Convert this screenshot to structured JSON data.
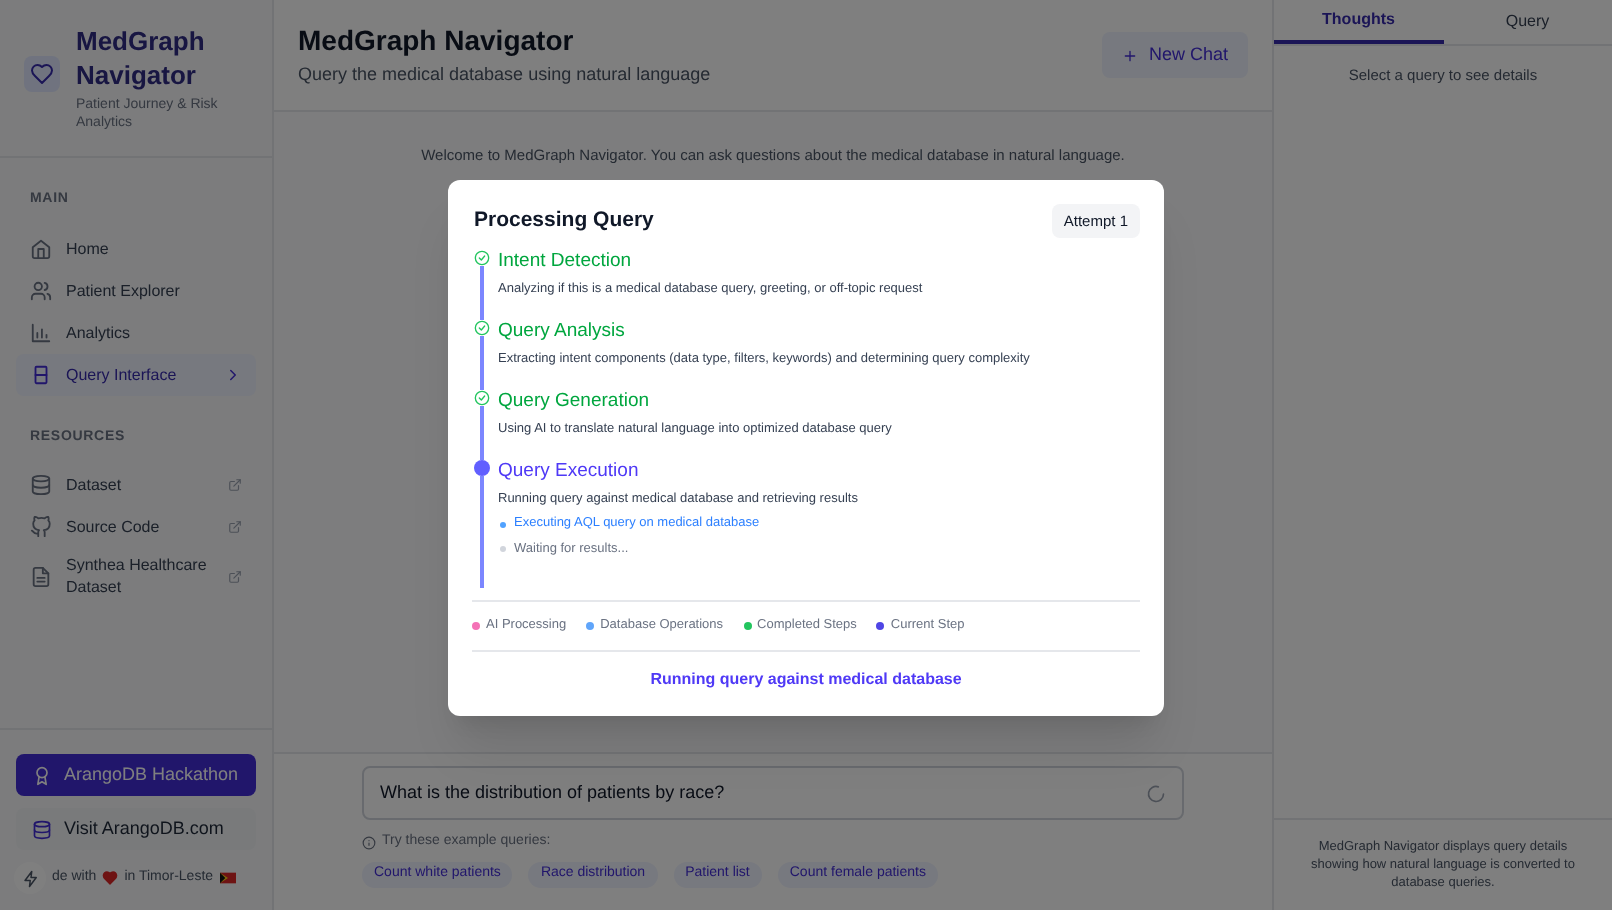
{
  "sidebar": {
    "app_title": "MedGraph Navigator",
    "app_subtitle": "Patient Journey & Risk Analytics",
    "sections": [
      {
        "title": "MAIN",
        "items": [
          {
            "label": "Home",
            "selected": false,
            "external": false
          },
          {
            "label": "Patient Explorer",
            "selected": false,
            "external": false
          },
          {
            "label": "Analytics",
            "selected": false,
            "external": false
          },
          {
            "label": "Query Interface",
            "selected": true,
            "external": false
          }
        ]
      },
      {
        "title": "RESOURCES",
        "items": [
          {
            "label": "Dataset",
            "selected": false,
            "external": true
          },
          {
            "label": "Source Code",
            "selected": false,
            "external": true
          },
          {
            "label": "Synthea Healthcare Dataset",
            "selected": false,
            "external": true
          }
        ]
      }
    ],
    "buttons": [
      {
        "label": "ArangoDB Hackathon",
        "kind": "primary"
      },
      {
        "label": "Visit ArangoDB.com",
        "kind": "secondary"
      }
    ],
    "footer": {
      "before": "de with",
      "after": "in Timor-Leste"
    }
  },
  "header": {
    "title": "MedGraph Navigator",
    "subtitle": "Query the medical database using natural language",
    "new_chat": "New Chat"
  },
  "welcome": "Welcome to MedGraph Navigator. You can ask questions about the medical database in natural language.",
  "query_input": {
    "value": "What is the distribution of patients by race?",
    "loading": true
  },
  "examples": {
    "hint": "Try these example queries:",
    "items": [
      "Count white patients",
      "Race distribution",
      "Patient list",
      "Count female patients"
    ]
  },
  "right_panel": {
    "tabs": [
      {
        "label": "Thoughts",
        "selected": true
      },
      {
        "label": "Query",
        "selected": false
      }
    ],
    "empty": "Select a query to see details",
    "footer": "MedGraph Navigator displays query details showing how natural language is converted to database queries."
  },
  "modal": {
    "title": "Processing Query",
    "attempt": "Attempt 1",
    "steps": [
      {
        "title": "Intent Detection",
        "description": "Analyzing if this is a medical database query, greeting, or off-topic request",
        "completed": true
      },
      {
        "title": "Query Analysis",
        "description": "Extracting intent components (data type, filters, keywords) and determining query complexity",
        "completed": true
      },
      {
        "title": "Query Generation",
        "description": "Using AI to translate natural language into optimized database query",
        "completed": true
      },
      {
        "title": "Query Execution",
        "description": "Running query against medical database and retrieving results",
        "completed": false,
        "substeps": [
          {
            "text": "Executing AQL query on medical database",
            "active": true
          },
          {
            "text": "Waiting for results...",
            "active": false
          }
        ]
      }
    ],
    "legend": [
      {
        "label": "AI Processing",
        "color": "#f472b6"
      },
      {
        "label": "Database Operations",
        "color": "#60a5fa"
      },
      {
        "label": "Completed Steps",
        "color": "#22c55e"
      },
      {
        "label": "Current Step",
        "color": "#4f46e5"
      }
    ],
    "status": "Running query against medical database"
  }
}
